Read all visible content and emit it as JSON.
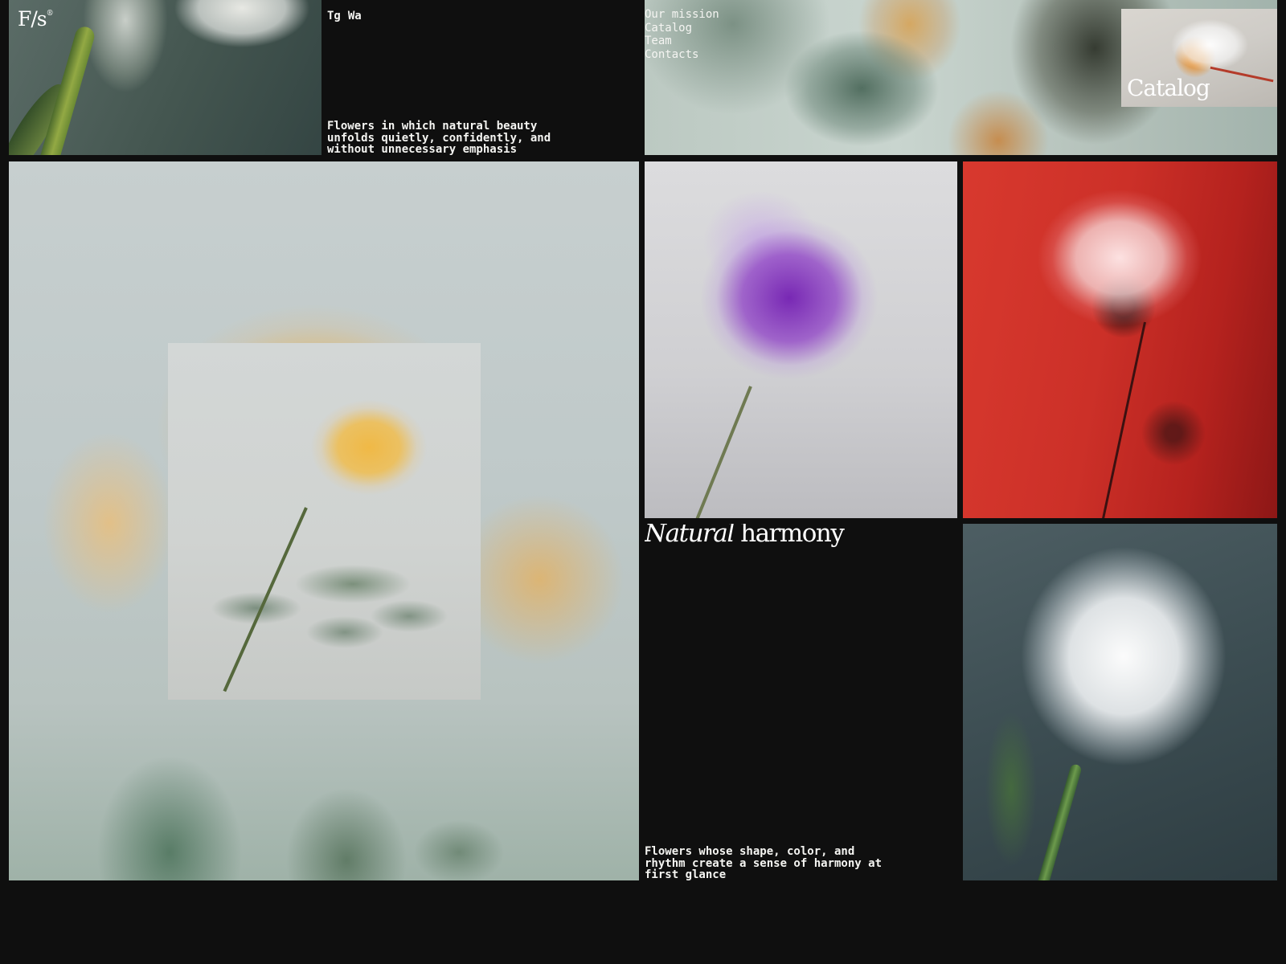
{
  "brand": {
    "logo": "F/s",
    "logo_mark": "®"
  },
  "socials": [
    {
      "label": "Tg"
    },
    {
      "label": "Wa"
    }
  ],
  "hero": {
    "tagline": "Flowers in which natural beauty unfolds quietly, confidently, and without unnecessary emphasis"
  },
  "nav": {
    "items": [
      {
        "label": "Our mission"
      },
      {
        "label": "Catalog"
      },
      {
        "label": "Team"
      },
      {
        "label": "Contacts"
      }
    ]
  },
  "catalog_card": {
    "label": "Catalog"
  },
  "harmony": {
    "title_italic": "Natural",
    "title_regular": "harmony",
    "description": "Flowers whose shape, color, and rhythm create a sense of harmony at first glance"
  },
  "images": {
    "lily": "calla-lily-photo",
    "blur_flowers": "blurred-flowers-photo",
    "catalog_thumb": "white-blossom-photo",
    "yellow_rose_big": "yellow-rose-blurred-photo",
    "yellow_rose_inset": "yellow-rose-photo",
    "purple_anemone": "purple-anemone-photo",
    "red_flower": "white-flower-on-red-photo",
    "white_tulip": "white-tulip-photo"
  },
  "colors": {
    "background": "#0f0f0f",
    "text": "#f5f5f2"
  }
}
